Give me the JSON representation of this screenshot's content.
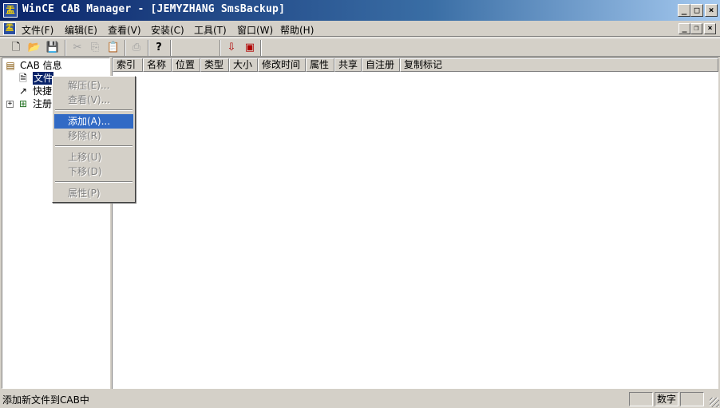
{
  "window": {
    "title": "WinCE CAB Manager - [JEMYZHANG SmsBackup]",
    "app_icon": "cab-manager-icon",
    "buttons": {
      "minimize": "_",
      "maximize": "□",
      "close": "×"
    }
  },
  "menubar": {
    "items": [
      "文件(F)",
      "编辑(E)",
      "查看(V)",
      "安装(C)",
      "工具(T)",
      "窗口(W)",
      "帮助(H)"
    ],
    "mdi_buttons": {
      "minimize": "_",
      "restore": "❐",
      "close": "×"
    }
  },
  "toolbar": {
    "buttons": [
      {
        "icon": "new-file-icon",
        "glyph": "🗋",
        "enabled": true
      },
      {
        "icon": "open-folder-icon",
        "glyph": "📂",
        "enabled": true
      },
      {
        "icon": "save-icon",
        "glyph": "💾",
        "enabled": true
      },
      {
        "icon": "cut-icon",
        "glyph": "✂",
        "enabled": false
      },
      {
        "icon": "copy-icon",
        "glyph": "⎘",
        "enabled": false
      },
      {
        "icon": "paste-icon",
        "glyph": "📋",
        "enabled": false
      },
      {
        "icon": "print-icon",
        "glyph": "⎙",
        "enabled": false
      },
      {
        "icon": "help-icon",
        "glyph": "?",
        "enabled": true
      },
      {
        "icon": "install-icon",
        "glyph": "⇩",
        "enabled": true
      },
      {
        "icon": "build-cab-icon",
        "glyph": "▣",
        "enabled": true
      }
    ]
  },
  "tree": {
    "root": {
      "label": "CAB 信息",
      "icon": "cab-info-icon"
    },
    "children": [
      {
        "label": "文件",
        "icon": "files-icon",
        "selected": true
      },
      {
        "label": "快捷",
        "icon": "shortcuts-icon",
        "selected": false
      },
      {
        "label": "注册",
        "icon": "registry-icon",
        "selected": false,
        "expander": "+"
      }
    ]
  },
  "list": {
    "columns": [
      "索引",
      "名称",
      "位置",
      "类型",
      "大小",
      "修改时间",
      "属性",
      "共享",
      "自注册",
      "复制标记"
    ]
  },
  "context_menu": {
    "items": [
      {
        "label": "解压(E)...",
        "enabled": false
      },
      {
        "label": "查看(V)...",
        "enabled": false
      },
      {
        "separator": true
      },
      {
        "label": "添加(A)...",
        "enabled": true,
        "highlighted": true
      },
      {
        "label": "移除(R)",
        "enabled": false
      },
      {
        "separator": true
      },
      {
        "label": "上移(U)",
        "enabled": false
      },
      {
        "label": "下移(D)",
        "enabled": false
      },
      {
        "separator": true
      },
      {
        "label": "属性(P)",
        "enabled": false
      }
    ]
  },
  "statusbar": {
    "text": "添加新文件到CAB中",
    "indicator": "数字"
  }
}
